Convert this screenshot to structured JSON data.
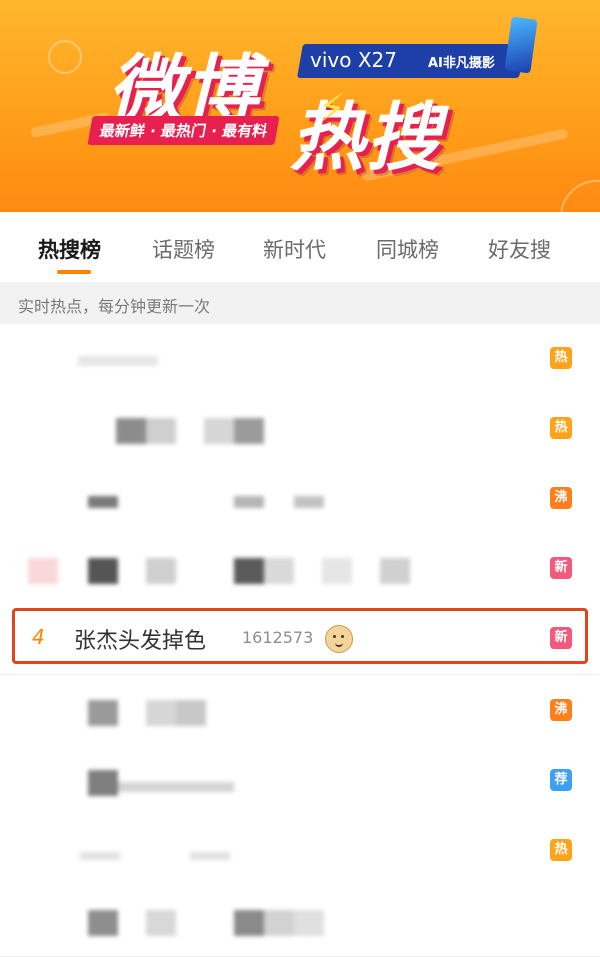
{
  "banner": {
    "title_main": "微博",
    "title_sub": "热搜",
    "slogan": "最新鲜 · 最热门 · 最有料",
    "ad_brand": "vivo X27",
    "ad_tagline": "AI非凡摄影"
  },
  "tabs": [
    {
      "label": "热搜榜",
      "active": true
    },
    {
      "label": "话题榜",
      "active": false
    },
    {
      "label": "新时代",
      "active": false
    },
    {
      "label": "同城榜",
      "active": false
    },
    {
      "label": "好友搜",
      "active": false
    }
  ],
  "subtitle": "实时热点，每分钟更新一次",
  "badge_colors": {
    "热": "#ffa31a",
    "沸": "#ff7f1c",
    "新": "#f25a7c",
    "荐": "#3ea0f3"
  },
  "list": [
    {
      "badge": "热",
      "blurred": true
    },
    {
      "badge": "热",
      "blurred": true
    },
    {
      "badge": "沸",
      "blurred": true
    },
    {
      "badge": "新",
      "blurred": true
    },
    {
      "rank": "4",
      "title": "张杰头发掉色",
      "count": "1612573",
      "emoji": "doge-emoji",
      "badge": "新",
      "highlighted": true
    },
    {
      "badge": "沸",
      "blurred": true
    },
    {
      "badge": "荐",
      "blurred": true
    },
    {
      "badge": "热",
      "blurred": true
    },
    {
      "badge": "",
      "blurred": true
    }
  ]
}
